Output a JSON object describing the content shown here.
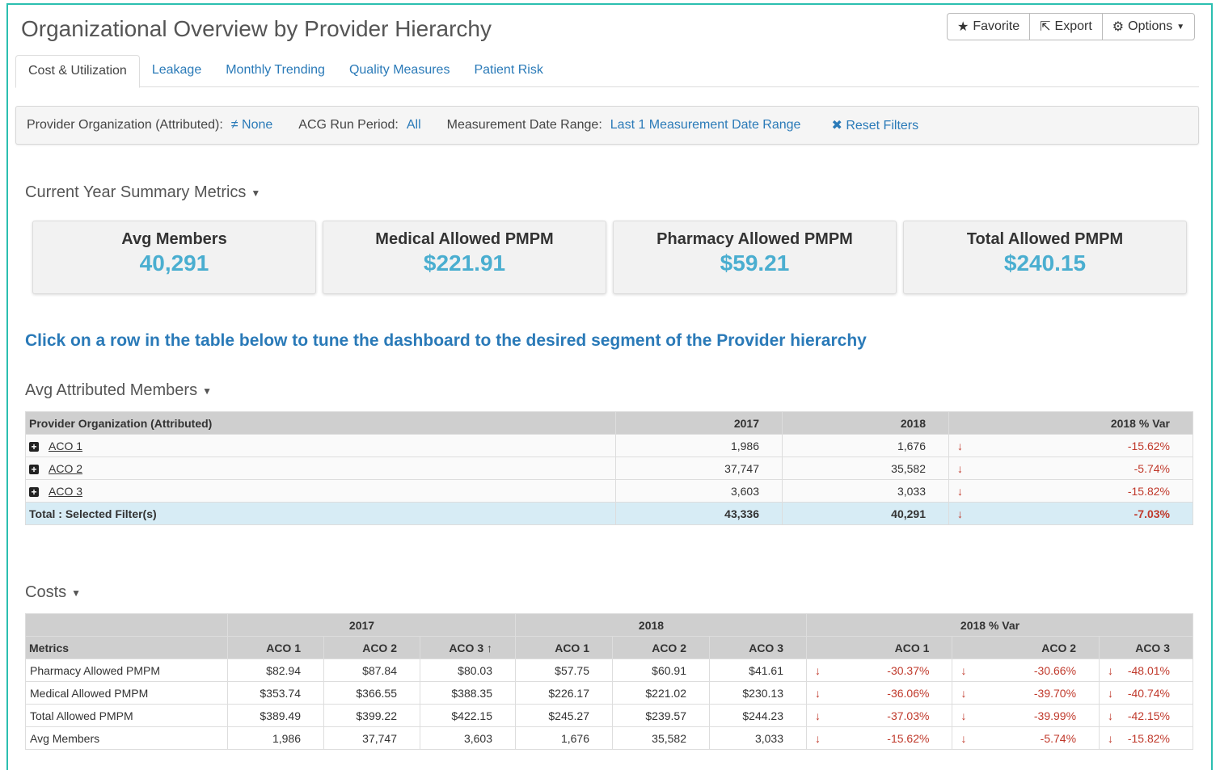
{
  "page": {
    "title": "Organizational Overview by Provider Hierarchy",
    "actions": {
      "favorite": "Favorite",
      "export": "Export",
      "options": "Options"
    }
  },
  "tabs": [
    "Cost & Utilization",
    "Leakage",
    "Monthly Trending",
    "Quality Measures",
    "Patient Risk"
  ],
  "filters": {
    "provider_label": "Provider Organization (Attributed):",
    "provider_value": "≠ None",
    "acg_label": "ACG Run Period:",
    "acg_value": "All",
    "date_label": "Measurement Date Range:",
    "date_value": "Last 1 Measurement Date Range",
    "reset": "Reset Filters"
  },
  "summary": {
    "title": "Current Year Summary Metrics",
    "cards": [
      {
        "label": "Avg Members",
        "value": "40,291"
      },
      {
        "label": "Medical Allowed PMPM",
        "value": "$221.91"
      },
      {
        "label": "Pharmacy Allowed PMPM",
        "value": "$59.21"
      },
      {
        "label": "Total Allowed PMPM",
        "value": "$240.15"
      }
    ]
  },
  "hint": "Click on a row in the table below to tune the dashboard to the desired segment of the Provider hierarchy",
  "members": {
    "title": "Avg Attributed Members",
    "headers": [
      "Provider Organization (Attributed)",
      "2017",
      "2018",
      "2018 % Var"
    ],
    "rows": [
      {
        "name": "ACO 1",
        "y2017": "1,986",
        "y2018": "1,676",
        "var": "-15.62%"
      },
      {
        "name": "ACO 2",
        "y2017": "37,747",
        "y2018": "35,582",
        "var": "-5.74%"
      },
      {
        "name": "ACO 3",
        "y2017": "3,603",
        "y2018": "3,033",
        "var": "-15.82%"
      }
    ],
    "total": {
      "name": "Total : Selected Filter(s)",
      "y2017": "43,336",
      "y2018": "40,291",
      "var": "-7.03%"
    }
  },
  "costs": {
    "title": "Costs",
    "groups": [
      "2017",
      "2018",
      "2018 % Var"
    ],
    "sub_headers": [
      "Metrics",
      "ACO 1",
      "ACO 2",
      "ACO 3",
      "ACO 1",
      "ACO 2",
      "ACO 3",
      "ACO 1",
      "ACO 2",
      "ACO 3"
    ],
    "rows": [
      {
        "metric": "Pharmacy Allowed PMPM",
        "v2017": [
          "$82.94",
          "$87.84",
          "$80.03"
        ],
        "v2018": [
          "$57.75",
          "$60.91",
          "$41.61"
        ],
        "var": [
          "-30.37%",
          "-30.66%",
          "-48.01%"
        ]
      },
      {
        "metric": "Medical Allowed PMPM",
        "v2017": [
          "$353.74",
          "$366.55",
          "$388.35"
        ],
        "v2018": [
          "$226.17",
          "$221.02",
          "$230.13"
        ],
        "var": [
          "-36.06%",
          "-39.70%",
          "-40.74%"
        ]
      },
      {
        "metric": "Total Allowed PMPM",
        "v2017": [
          "$389.49",
          "$399.22",
          "$422.15"
        ],
        "v2018": [
          "$245.27",
          "$239.57",
          "$244.23"
        ],
        "var": [
          "-37.03%",
          "-39.99%",
          "-42.15%"
        ]
      },
      {
        "metric": "Avg Members",
        "v2017": [
          "1,986",
          "37,747",
          "3,603"
        ],
        "v2018": [
          "1,676",
          "35,582",
          "3,033"
        ],
        "var": [
          "-15.62%",
          "-5.74%",
          "-15.82%"
        ]
      }
    ]
  }
}
